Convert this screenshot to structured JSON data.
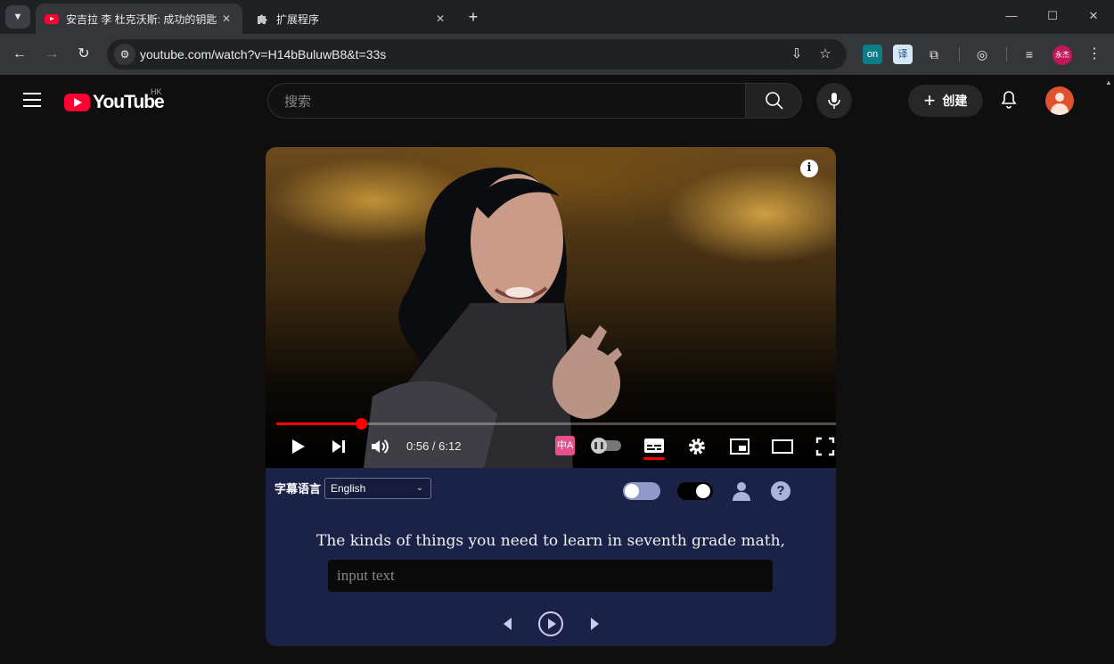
{
  "browser": {
    "tabs": [
      {
        "title": "安吉拉 李 杜克沃斯: 成功的钥匙",
        "icon": "youtube-icon",
        "active": true
      },
      {
        "title": "扩展程序",
        "icon": "puzzle-icon",
        "active": false
      }
    ],
    "url": "youtube.com/watch?v=H14bBuluwB8&t=33s",
    "profile_label": "永杰"
  },
  "youtube": {
    "logo_text": "YouTube",
    "country_code": "HK",
    "search_placeholder": "搜索",
    "create_label": "创建"
  },
  "player": {
    "current_time": "0:56",
    "duration": "6:12",
    "time_display": "0:56 / 6:12",
    "progress_fraction": 0.1505,
    "translate_icon_text": "中A",
    "captions_on": true
  },
  "subtitle_panel": {
    "language_label": "字幕语言",
    "language_value": "English",
    "current_subtitle": "The kinds of things you need to learn in seventh grade math,",
    "input_placeholder": "input text",
    "help_glyph": "?"
  },
  "colors": {
    "youtube_red": "#ff0033",
    "progress_red": "#ff0000",
    "panel_bg": "#1a2248",
    "translate_pink": "#e84f8c"
  }
}
